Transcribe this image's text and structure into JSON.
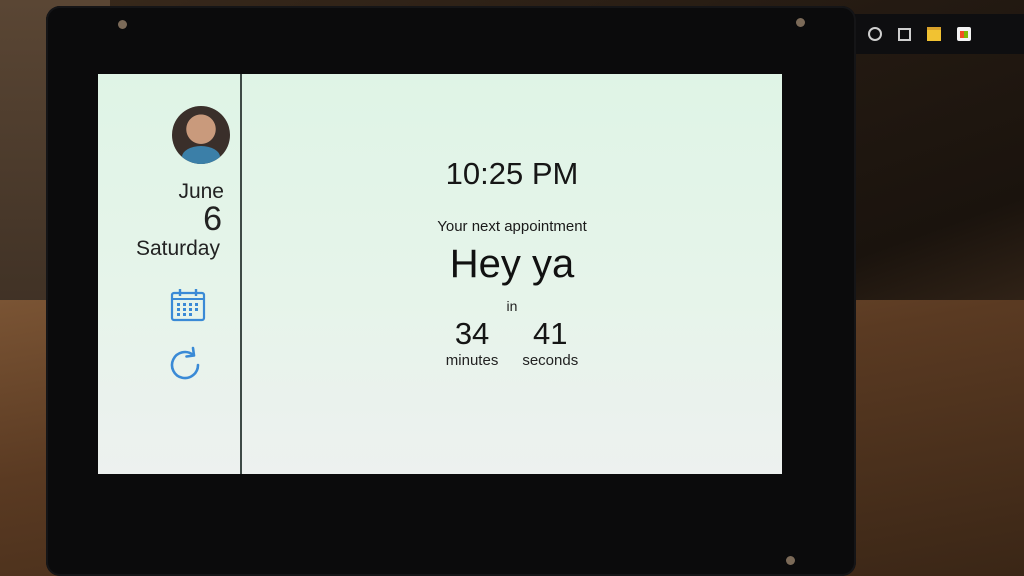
{
  "sidebar": {
    "date": {
      "month": "June",
      "day": "6",
      "weekday": "Saturday"
    }
  },
  "main": {
    "time": "10:25 PM",
    "next_label": "Your next appointment",
    "appointment_title": "Hey ya",
    "in_label": "in",
    "countdown": {
      "minutes_value": "34",
      "minutes_label": "minutes",
      "seconds_value": "41",
      "seconds_label": "seconds"
    }
  },
  "colors": {
    "accent": "#3a8ad6",
    "screen_bg": "#e3f3e8",
    "text": "#161616"
  },
  "icons": [
    "calendar-icon",
    "refresh-icon",
    "cortana-icon",
    "task-view-icon",
    "file-explorer-icon",
    "store-icon"
  ]
}
